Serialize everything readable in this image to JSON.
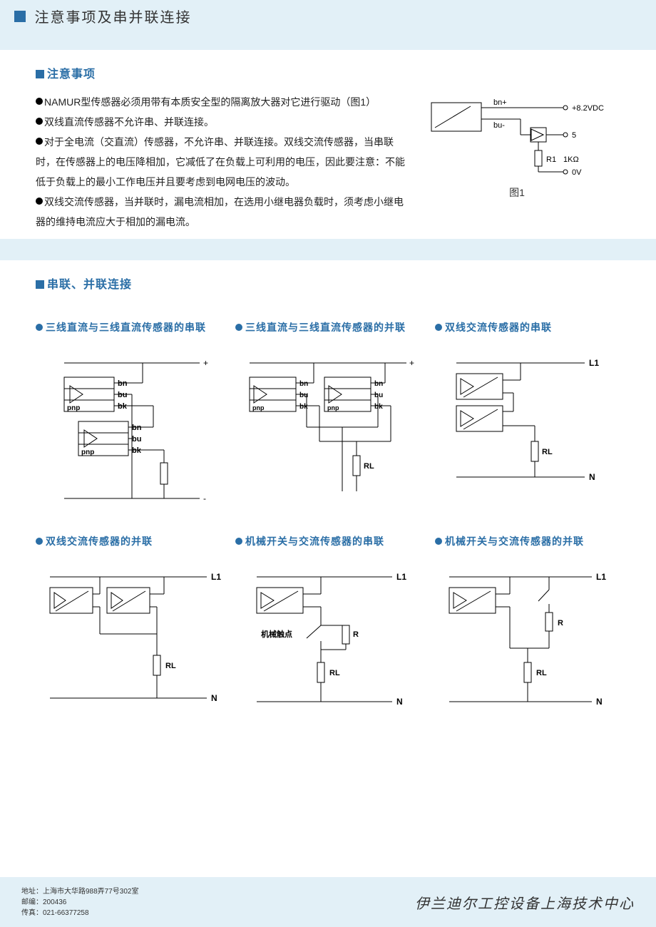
{
  "header": {
    "title": "注意事项及串并联连接"
  },
  "notes": {
    "heading": "注意事项",
    "items": [
      "NAMUR型传感器必须用带有本质安全型的隔离放大器对它进行驱动（图1）",
      "双线直流传感器不允许串、并联连接。",
      "对于全电流（交直流）传感器，不允许串、并联连接。双线交流传感器，当串联时，在传感器上的电压降相加，它减低了在负载上可利用的电压，因此要注意：不能低于负载上的最小工作电压并且要考虑到电网电压的波动。",
      "双线交流传感器，当并联时，漏电流相加，在选用小继电器负载时，须考虑小继电器的维持电流应大于相加的漏电流。"
    ],
    "figure1_label": "图1",
    "fig1": {
      "bn": "bn+",
      "bu": "bu-",
      "v82": "+8.2VDC",
      "five": "5",
      "r1": "R1",
      "onek": "1KΩ",
      "ov": "0V"
    }
  },
  "connections": {
    "heading": "串联、并联连接",
    "diagrams": [
      {
        "title": "三线直流与三线直流传感器的串联",
        "labels": {
          "plus": "+",
          "minus": "-",
          "bn": "bn",
          "bu": "bu",
          "bk": "bk",
          "pnp": "pnp"
        }
      },
      {
        "title": "三线直流与三线直流传感器的并联",
        "labels": {
          "plus": "+",
          "bn": "bn",
          "bu": "bu",
          "bk": "bk",
          "pnp": "pnp",
          "rl": "RL"
        }
      },
      {
        "title": "双线交流传感器的串联",
        "labels": {
          "l1": "L1",
          "n": "N",
          "rl": "RL"
        }
      },
      {
        "title": "双线交流传感器的并联",
        "labels": {
          "l1": "L1",
          "n": "N",
          "rl": "RL"
        }
      },
      {
        "title": "机械开关与交流传感器的串联",
        "labels": {
          "l1": "L1",
          "n": "N",
          "rl": "RL",
          "r": "R",
          "contact": "机械触点"
        }
      },
      {
        "title": "机械开关与交流传感器的并联",
        "labels": {
          "l1": "L1",
          "n": "N",
          "rl": "RL",
          "r": "R"
        }
      }
    ]
  },
  "footer": {
    "address_label": "地址：",
    "address": "上海市大华路988弄77号302室",
    "zip_label": "邮编：",
    "zip": "200436",
    "fax_label": "传真：",
    "fax": "021-66377258",
    "company": "伊兰迪尔工控设备上海技术中心"
  }
}
